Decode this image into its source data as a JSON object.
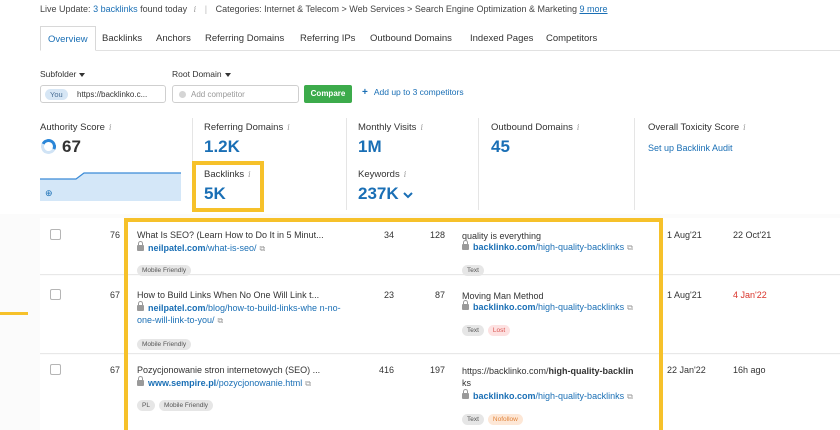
{
  "live_update": {
    "prefix": "Live Update:",
    "backlinks_link": "3 backlinks",
    "suffix": "found today",
    "info": "i",
    "categories_label": "Categories:",
    "categories": "Internet & Telecom > Web Services > Search Engine Optimization & Marketing",
    "more_link": "9 more"
  },
  "tabs": [
    "Overview",
    "Backlinks",
    "Anchors",
    "Referring Domains",
    "Referring IPs",
    "Outbound Domains",
    "Indexed Pages",
    "Competitors"
  ],
  "filters": {
    "subfolder_label": "Subfolder",
    "root_domain_label": "Root Domain",
    "you_badge": "You",
    "domain_value": "https://backlinko.c...",
    "competitor_placeholder": "Add competitor",
    "compare_button": "Compare",
    "add_competitors": "Add up to 3 competitors"
  },
  "metrics": {
    "authority_label": "Authority Score",
    "authority_value": "67",
    "referring_domains_label": "Referring Domains",
    "referring_domains_value": "1.2K",
    "backlinks_label": "Backlinks",
    "backlinks_value": "5K",
    "monthly_visits_label": "Monthly Visits",
    "monthly_visits_value": "1M",
    "keywords_label": "Keywords",
    "keywords_value": "237K",
    "outbound_label": "Outbound Domains",
    "outbound_value": "45",
    "toxicity_label": "Overall Toxicity Score",
    "toxicity_link": "Set up Backlink Audit",
    "info_glyph": "i"
  },
  "rows": [
    {
      "score": "76",
      "title": "What Is SEO? (Learn How to Do It in 5 Minut...",
      "domain": "neilpatel.com",
      "path": "/what-is-seo/",
      "tags": [
        "Mobile Friendly"
      ],
      "ext_links": "34",
      "int_links": "128",
      "anchor": "quality is everything",
      "target_domain": "backlinko.com",
      "target_path": "/high-quality-backlinks",
      "anchor_tags": [
        "Text"
      ],
      "first_seen": "1 Aug'21",
      "last_seen": "22 Oct'21"
    },
    {
      "score": "67",
      "title": "How to Build Links When No One Will Link t...",
      "domain": "neilpatel.com",
      "path": "/blog/how-to-build-links-whe n-no-one-will-link-to-you/",
      "tags": [
        "Mobile Friendly"
      ],
      "ext_links": "23",
      "int_links": "87",
      "anchor": "Moving Man Method",
      "target_domain": "backlinko.com",
      "target_path": "/high-quality-backlinks",
      "anchor_tags": [
        "Text",
        "Lost"
      ],
      "first_seen": "1 Aug'21",
      "last_seen": "4 Jan'22"
    },
    {
      "score": "67",
      "title": "Pozycjonowanie stron internetowych (SEO) ...",
      "domain": "www.sempire.pl",
      "path": "/pozycjonowanie.html",
      "tags": [
        "PL",
        "Mobile Friendly"
      ],
      "ext_links": "416",
      "int_links": "197",
      "anchor_prefix": "https://backlinko.com/",
      "anchor_bold": "high-quality-backlin",
      "anchor_rest": "ks",
      "target_domain": "backlinko.com",
      "target_path": "/high-quality-backlinks",
      "anchor_tags": [
        "Text",
        "Nofollow"
      ],
      "first_seen": "22 Jan'22",
      "last_seen": "16h ago"
    }
  ],
  "icons": {
    "external": "⧉",
    "zoom": "⊕"
  },
  "colors": {
    "accent": "#1a6fb5",
    "highlight": "#f6c12a",
    "compare": "#3cab4b",
    "lost": "#d9342b"
  }
}
